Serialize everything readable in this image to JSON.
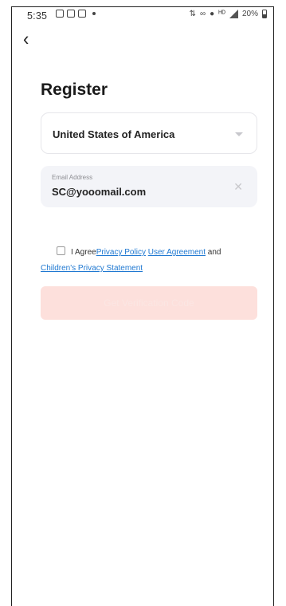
{
  "status_bar": {
    "time": "5:35",
    "battery": "20%",
    "icons": [
      "image-icon",
      "cast-icon",
      "gallery-icon",
      "notification-dot-icon",
      "data-speed-icon",
      "link-icon",
      "location-icon",
      "hd-icon",
      "signal-icon",
      "battery-icon"
    ]
  },
  "nav": {
    "back_icon": "chevron-left-icon"
  },
  "page": {
    "title": "Register"
  },
  "country_select": {
    "value": "United States of America",
    "icon": "dropdown-arrow-icon"
  },
  "email_field": {
    "label": "Email Address",
    "value": "SC@yooomail.com",
    "clear_icon": "close-icon"
  },
  "agreement": {
    "prefix": "I Agree",
    "privacy_policy": "Privacy Policy",
    "user_agreement": "User Agreement",
    "conjunction": "and",
    "children_privacy": "Children's Privacy Statement",
    "checked": false
  },
  "cta": {
    "label": "Get Verification Code",
    "enabled": false
  },
  "colors": {
    "link": "#1f78d1",
    "cta_bg_disabled": "#fde0dc",
    "field_bg": "#f3f4f8"
  }
}
